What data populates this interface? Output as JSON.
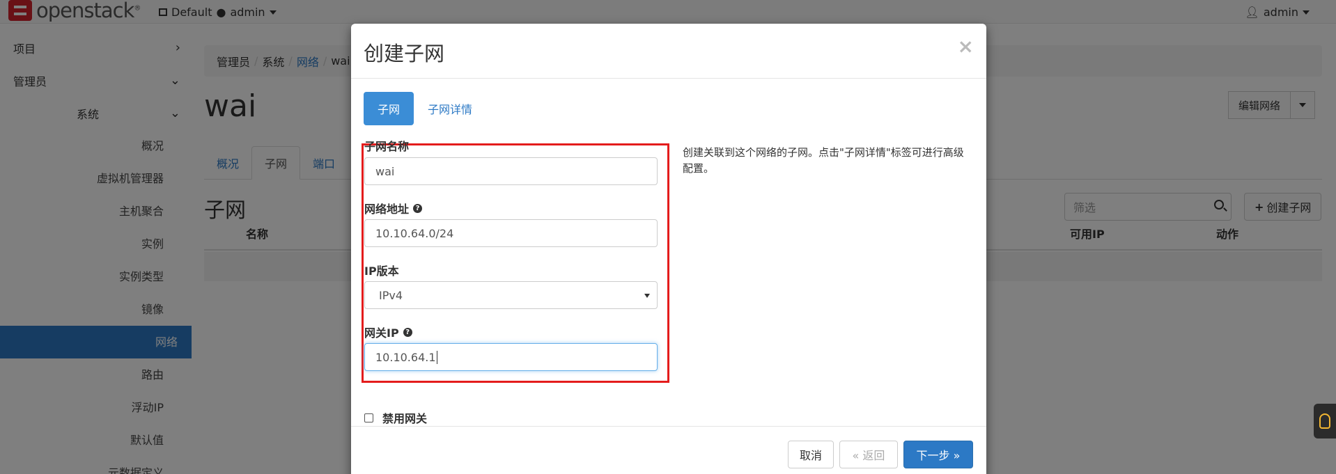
{
  "navbar": {
    "brand": "openstack",
    "brand_mark": "®",
    "project": "Default",
    "project_user": "admin",
    "user": "admin"
  },
  "sidebar": {
    "items": [
      {
        "label": "项目",
        "chevron": "›"
      },
      {
        "label": "管理员",
        "chevron": "⌄"
      }
    ],
    "group": {
      "label": "系统",
      "chevron": "⌄"
    },
    "subitems": [
      "概况",
      "虚拟机管理器",
      "主机聚合",
      "实例",
      "实例类型",
      "镜像",
      "网络",
      "路由",
      "浮动IP",
      "默认值",
      "元数据定义"
    ],
    "active": "网络"
  },
  "main": {
    "breadcrumb": [
      "管理员",
      "系统",
      "网络",
      "wai"
    ],
    "title": "wai",
    "edit_button": "编辑网络",
    "tabs": [
      "概况",
      "子网",
      "端口"
    ],
    "active_tab": "子网",
    "sub_heading": "子网",
    "filter_placeholder": "筛选",
    "create_button": "创建子网",
    "columns": {
      "name": "名称",
      "available_ip": "可用IP",
      "actions": "动作"
    }
  },
  "modal": {
    "title": "创建子网",
    "close": "×",
    "tabs": [
      "子网",
      "子网详情"
    ],
    "active_tab": "子网",
    "fields": {
      "subnet_name": {
        "label": "子网名称",
        "value": "wai"
      },
      "network_address": {
        "label": "网络地址",
        "value": "10.10.64.0/24"
      },
      "ip_version": {
        "label": "IP版本",
        "value": "IPv4"
      },
      "gateway_ip": {
        "label": "网关IP",
        "value": "10.10.64.1"
      }
    },
    "disable_gateway": {
      "label": "禁用网关",
      "checked": false
    },
    "help_text": "创建关联到这个网络的子网。点击\"子网详情\"标签可进行高级配置。",
    "buttons": {
      "cancel": "取消",
      "back": "« 返回",
      "next": "下一步 »"
    }
  },
  "colors": {
    "accent": "#2c79c5",
    "highlight": "#e41c1c",
    "logo": "#d2222d"
  }
}
